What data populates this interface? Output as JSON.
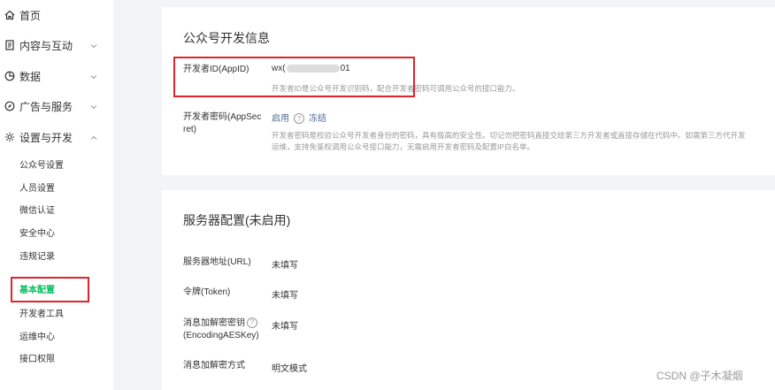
{
  "sidebar": {
    "top_items": [
      {
        "label": "首页",
        "icon": "home-icon"
      },
      {
        "label": "内容与互动",
        "icon": "document-icon"
      },
      {
        "label": "数据",
        "icon": "pie-chart-icon"
      },
      {
        "label": "广告与服务",
        "icon": "compass-icon"
      },
      {
        "label": "设置与开发",
        "icon": "gear-icon"
      }
    ],
    "sub_items": [
      {
        "label": "公众号设置"
      },
      {
        "label": "人员设置"
      },
      {
        "label": "微信认证"
      },
      {
        "label": "安全中心"
      },
      {
        "label": "违规记录"
      },
      {
        "label": "基本配置"
      },
      {
        "label": "开发者工具"
      },
      {
        "label": "运维中心"
      },
      {
        "label": "接口权限"
      }
    ],
    "active_sub_item": "基本配置"
  },
  "dev_info": {
    "title": "公众号开发信息",
    "appid_label": "开发者ID(AppID)",
    "appid_prefix": "wx(",
    "appid_suffix": "01",
    "appid_desc": "开发者ID是公众号开发识别码，配合开发者密码可调用公众号的接口能力。",
    "secret_label_line1": "开发者密码(AppSec",
    "secret_label_line2": "ret)",
    "secret_enable": "启用",
    "secret_help": "?",
    "secret_freeze": "冻结",
    "secret_desc_line1": "开发者密码是校验公众号开发者身份的密码，具有极高的安全性。切记勿把密码直接交给第三方开发者或直接存储在代码中。如需第三方代开发",
    "secret_desc_line2": "运维，支持免鉴权调用公众号接口能力，无需启用开发者密码及配置IP白名单。"
  },
  "server_config": {
    "title": "服务器配置(未启用)",
    "url_label": "服务器地址(URL)",
    "url_value": "未填写",
    "token_label": "令牌(Token)",
    "token_value": "未填写",
    "aeskey_label_line1": "消息加解密密钥",
    "aeskey_label_line2": "(EncodingAESKey)",
    "aeskey_help": "?",
    "aeskey_value": "未填写",
    "mode_label": "消息加解密方式",
    "mode_value": "明文模式"
  },
  "watermark": "CSDN @子木凝烟",
  "colors": {
    "accent": "#07c160",
    "highlight_box": "#e0242b",
    "link": "#576b95"
  }
}
